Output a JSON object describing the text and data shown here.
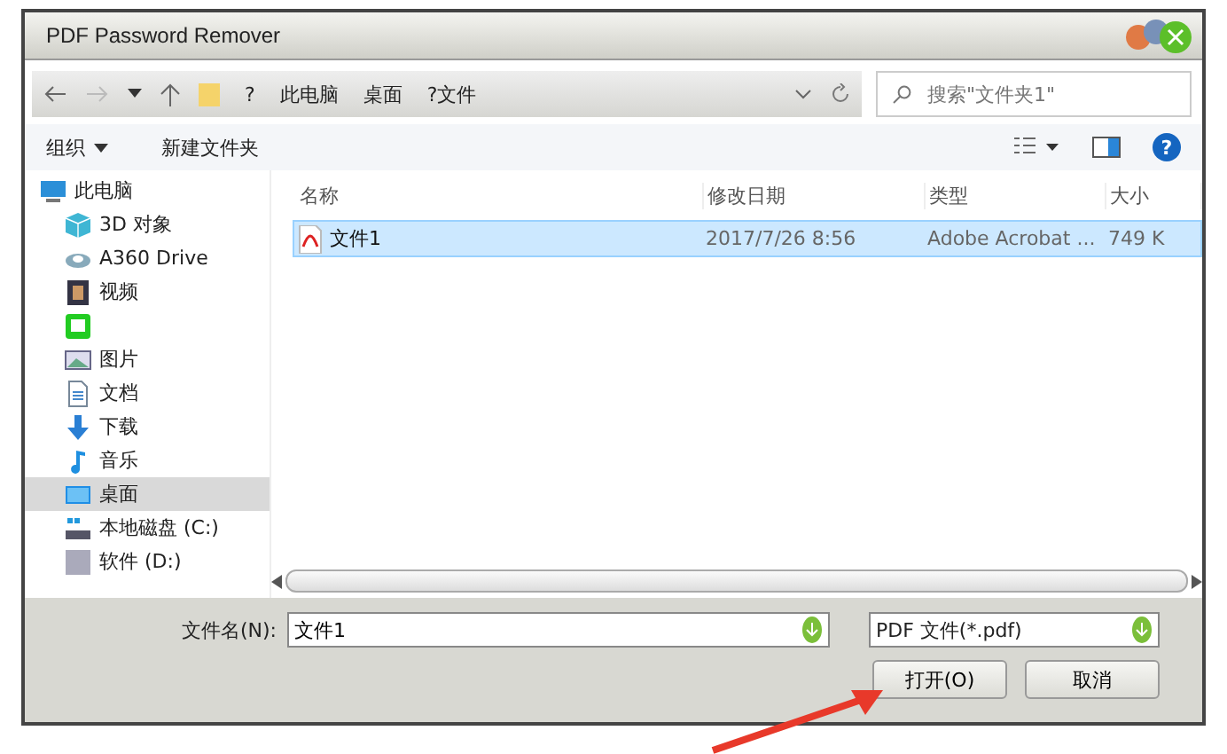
{
  "window": {
    "title": "PDF Password Remover"
  },
  "nav": {
    "breadcrumb": [
      "?",
      "此电脑",
      "桌面",
      "?文件"
    ],
    "search": {
      "placeholder": "搜索\"文件夹1\""
    }
  },
  "toolbar": {
    "organize": "组织",
    "new_folder": "新建文件夹",
    "help": "?"
  },
  "sidebar": {
    "items": [
      {
        "label": "此电脑",
        "selected": false
      },
      {
        "label": "3D 对象",
        "selected": false
      },
      {
        "label": "A360 Drive",
        "selected": false
      },
      {
        "label": "视频",
        "selected": false
      },
      {
        "selected": false
      },
      {
        "label": "图片",
        "selected": false
      },
      {
        "label": "文档",
        "selected": false
      },
      {
        "label": "下载",
        "selected": false
      },
      {
        "label": "音乐",
        "selected": false
      },
      {
        "label": "桌面",
        "selected": true
      },
      {
        "label": "本地磁盘 (C:)",
        "selected": false
      },
      {
        "label": "软件 (D:)",
        "selected": false
      }
    ]
  },
  "table": {
    "columns": [
      "名称",
      "修改日期",
      "类型",
      "大小"
    ],
    "rows": [
      {
        "cells": [
          "文件1",
          "2017/7/26 8:56",
          "Adobe Acrobat ...",
          "749 K"
        ],
        "selected": true
      }
    ]
  },
  "footer": {
    "filename_label": "文件名(N):",
    "filename": "文件1",
    "filetype": "PDF 文件(*.pdf)",
    "buttons": [
      "打开(O)",
      "取消"
    ]
  }
}
